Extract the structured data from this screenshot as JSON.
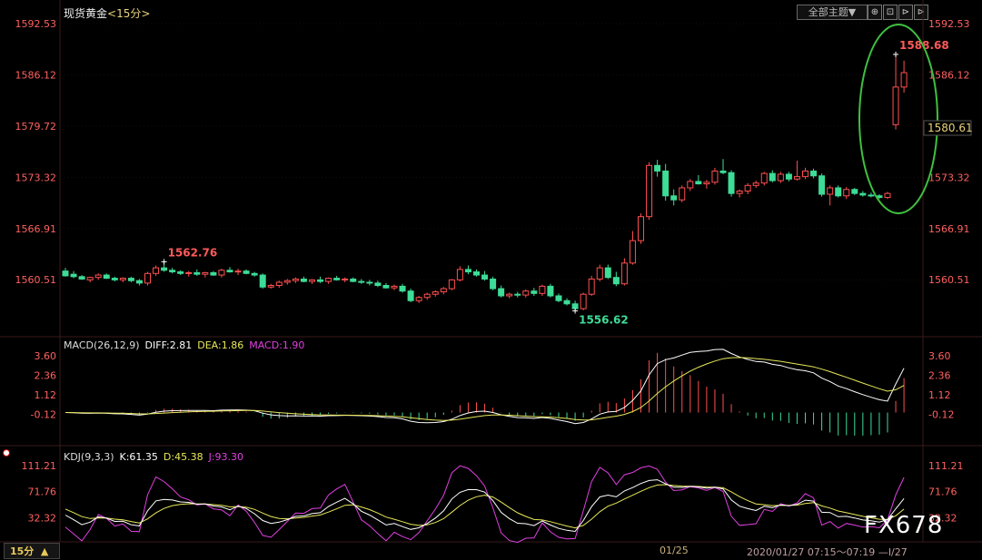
{
  "header": {
    "instrument": "现货黄金",
    "period": "<15分>"
  },
  "toolbar": {
    "theme_label": "全部主题▼",
    "btn1": "⊕",
    "btn2": "⊡",
    "btn3": "⊳",
    "btn4": "⊳"
  },
  "price_axis": {
    "left": [
      "1592.53",
      "1586.12",
      "1579.72",
      "1573.32",
      "1566.91",
      "1560.51"
    ],
    "right": [
      "1592.53",
      "1586.12",
      "1573.32",
      "1566.91",
      "1560.51"
    ],
    "current": "1580.61"
  },
  "annotations": {
    "high_a": "1562.76",
    "low": "1556.62",
    "high_b": "1588.68"
  },
  "macd": {
    "title": "MACD(26,12,9)",
    "diff_label": "DIFF:2.81",
    "dea_label": "DEA:1.86",
    "macd_label": "MACD:1.90",
    "ticks": [
      "3.60",
      "2.36",
      "1.12",
      "-0.12"
    ]
  },
  "kdj": {
    "title": "KDJ(9,3,3)",
    "k_label": "K:61.35",
    "d_label": "D:45.38",
    "j_label": "J:93.30",
    "ticks": [
      "111.21",
      "71.76",
      "32.32"
    ]
  },
  "footer": {
    "period_button": "15分",
    "period_arrow": "▲",
    "date": "01/25",
    "range": "2020/01/27 07:15～07:19",
    "range_end": "—I/27"
  },
  "watermark": "FX678",
  "colors": {
    "up": "#ff4f4f",
    "down": "#3ddc97",
    "diff": "#ffffff",
    "dea": "#e8e85a",
    "j": "#e040e0",
    "highlight": "#3fbf3f"
  },
  "chart_data": {
    "type": "candlestick",
    "instrument": "现货黄金",
    "interval": "15分",
    "ylim": [
      1556.0,
      1592.53
    ],
    "candles": [
      {
        "o": 1561.6,
        "h": 1562.0,
        "l": 1560.9,
        "c": 1561.0
      },
      {
        "o": 1561.2,
        "h": 1561.6,
        "l": 1560.7,
        "c": 1560.9
      },
      {
        "o": 1560.9,
        "h": 1561.1,
        "l": 1560.5,
        "c": 1560.6
      },
      {
        "o": 1560.5,
        "h": 1560.9,
        "l": 1560.2,
        "c": 1560.8
      },
      {
        "o": 1560.8,
        "h": 1561.3,
        "l": 1560.5,
        "c": 1561.1
      },
      {
        "o": 1561.1,
        "h": 1561.3,
        "l": 1560.6,
        "c": 1560.7
      },
      {
        "o": 1560.7,
        "h": 1560.9,
        "l": 1560.3,
        "c": 1560.5
      },
      {
        "o": 1560.5,
        "h": 1560.8,
        "l": 1560.2,
        "c": 1560.7
      },
      {
        "o": 1560.7,
        "h": 1560.9,
        "l": 1560.2,
        "c": 1560.4
      },
      {
        "o": 1560.4,
        "h": 1560.6,
        "l": 1559.8,
        "c": 1560.1
      },
      {
        "o": 1560.1,
        "h": 1561.5,
        "l": 1559.8,
        "c": 1561.3
      },
      {
        "o": 1561.3,
        "h": 1562.3,
        "l": 1561.0,
        "c": 1562.0
      },
      {
        "o": 1562.0,
        "h": 1562.76,
        "l": 1561.5,
        "c": 1561.7
      },
      {
        "o": 1561.7,
        "h": 1562.0,
        "l": 1561.3,
        "c": 1561.5
      },
      {
        "o": 1561.5,
        "h": 1561.7,
        "l": 1561.1,
        "c": 1561.3
      },
      {
        "o": 1561.3,
        "h": 1561.6,
        "l": 1560.9,
        "c": 1561.4
      },
      {
        "o": 1561.4,
        "h": 1561.8,
        "l": 1561.0,
        "c": 1561.2
      },
      {
        "o": 1561.2,
        "h": 1561.5,
        "l": 1560.8,
        "c": 1561.4
      },
      {
        "o": 1561.4,
        "h": 1561.6,
        "l": 1561.0,
        "c": 1561.1
      },
      {
        "o": 1561.1,
        "h": 1561.9,
        "l": 1560.8,
        "c": 1561.7
      },
      {
        "o": 1561.7,
        "h": 1562.1,
        "l": 1561.4,
        "c": 1561.5
      },
      {
        "o": 1561.5,
        "h": 1561.9,
        "l": 1561.1,
        "c": 1561.6
      },
      {
        "o": 1561.6,
        "h": 1561.8,
        "l": 1561.2,
        "c": 1561.3
      },
      {
        "o": 1561.3,
        "h": 1561.5,
        "l": 1560.9,
        "c": 1561.1
      },
      {
        "o": 1561.1,
        "h": 1561.3,
        "l": 1559.4,
        "c": 1559.6
      },
      {
        "o": 1559.6,
        "h": 1560.0,
        "l": 1559.4,
        "c": 1559.8
      },
      {
        "o": 1559.8,
        "h": 1560.4,
        "l": 1559.5,
        "c": 1560.2
      },
      {
        "o": 1560.2,
        "h": 1560.6,
        "l": 1559.9,
        "c": 1560.4
      },
      {
        "o": 1560.4,
        "h": 1560.8,
        "l": 1560.1,
        "c": 1560.6
      },
      {
        "o": 1560.6,
        "h": 1560.9,
        "l": 1560.2,
        "c": 1560.3
      },
      {
        "o": 1560.3,
        "h": 1560.6,
        "l": 1560.0,
        "c": 1560.5
      },
      {
        "o": 1560.5,
        "h": 1560.9,
        "l": 1560.1,
        "c": 1560.3
      },
      {
        "o": 1560.3,
        "h": 1560.8,
        "l": 1560.0,
        "c": 1560.7
      },
      {
        "o": 1560.7,
        "h": 1561.0,
        "l": 1560.4,
        "c": 1560.5
      },
      {
        "o": 1560.5,
        "h": 1560.8,
        "l": 1560.2,
        "c": 1560.6
      },
      {
        "o": 1560.6,
        "h": 1560.8,
        "l": 1560.2,
        "c": 1560.3
      },
      {
        "o": 1560.3,
        "h": 1560.6,
        "l": 1560.0,
        "c": 1560.2
      },
      {
        "o": 1560.2,
        "h": 1560.5,
        "l": 1559.8,
        "c": 1560.1
      },
      {
        "o": 1560.1,
        "h": 1560.4,
        "l": 1559.6,
        "c": 1559.8
      },
      {
        "o": 1559.8,
        "h": 1560.1,
        "l": 1559.4,
        "c": 1559.5
      },
      {
        "o": 1559.5,
        "h": 1559.9,
        "l": 1559.2,
        "c": 1559.7
      },
      {
        "o": 1559.7,
        "h": 1560.0,
        "l": 1558.9,
        "c": 1559.1
      },
      {
        "o": 1559.1,
        "h": 1559.4,
        "l": 1557.7,
        "c": 1557.9
      },
      {
        "o": 1557.9,
        "h": 1558.5,
        "l": 1557.6,
        "c": 1558.3
      },
      {
        "o": 1558.3,
        "h": 1558.9,
        "l": 1558.0,
        "c": 1558.7
      },
      {
        "o": 1558.7,
        "h": 1559.2,
        "l": 1558.4,
        "c": 1559.0
      },
      {
        "o": 1559.0,
        "h": 1559.6,
        "l": 1558.7,
        "c": 1559.4
      },
      {
        "o": 1559.4,
        "h": 1560.6,
        "l": 1559.2,
        "c": 1560.5
      },
      {
        "o": 1560.5,
        "h": 1562.2,
        "l": 1560.3,
        "c": 1561.8
      },
      {
        "o": 1561.8,
        "h": 1562.3,
        "l": 1561.2,
        "c": 1561.5
      },
      {
        "o": 1561.5,
        "h": 1561.8,
        "l": 1560.9,
        "c": 1561.1
      },
      {
        "o": 1561.1,
        "h": 1561.6,
        "l": 1560.4,
        "c": 1560.6
      },
      {
        "o": 1560.6,
        "h": 1560.9,
        "l": 1559.2,
        "c": 1559.4
      },
      {
        "o": 1559.4,
        "h": 1559.8,
        "l": 1558.3,
        "c": 1558.5
      },
      {
        "o": 1558.5,
        "h": 1558.9,
        "l": 1558.2,
        "c": 1558.7
      },
      {
        "o": 1558.7,
        "h": 1559.0,
        "l": 1558.3,
        "c": 1558.6
      },
      {
        "o": 1558.6,
        "h": 1559.3,
        "l": 1558.3,
        "c": 1559.1
      },
      {
        "o": 1559.1,
        "h": 1559.5,
        "l": 1558.5,
        "c": 1558.8
      },
      {
        "o": 1558.8,
        "h": 1559.9,
        "l": 1558.5,
        "c": 1559.7
      },
      {
        "o": 1559.7,
        "h": 1560.0,
        "l": 1558.3,
        "c": 1558.5
      },
      {
        "o": 1558.5,
        "h": 1558.8,
        "l": 1557.7,
        "c": 1557.9
      },
      {
        "o": 1557.9,
        "h": 1558.2,
        "l": 1557.3,
        "c": 1557.5
      },
      {
        "o": 1557.5,
        "h": 1557.9,
        "l": 1556.62,
        "c": 1556.9
      },
      {
        "o": 1556.9,
        "h": 1558.9,
        "l": 1556.7,
        "c": 1558.7
      },
      {
        "o": 1558.7,
        "h": 1561.0,
        "l": 1558.5,
        "c": 1560.6
      },
      {
        "o": 1560.6,
        "h": 1562.4,
        "l": 1560.3,
        "c": 1562.0
      },
      {
        "o": 1562.0,
        "h": 1562.4,
        "l": 1560.6,
        "c": 1560.8
      },
      {
        "o": 1560.8,
        "h": 1561.5,
        "l": 1559.7,
        "c": 1560.0
      },
      {
        "o": 1560.0,
        "h": 1563.2,
        "l": 1559.8,
        "c": 1562.6
      },
      {
        "o": 1562.6,
        "h": 1566.6,
        "l": 1562.4,
        "c": 1565.4
      },
      {
        "o": 1565.4,
        "h": 1568.8,
        "l": 1565.0,
        "c": 1568.4
      },
      {
        "o": 1568.4,
        "h": 1575.2,
        "l": 1568.0,
        "c": 1574.8
      },
      {
        "o": 1574.8,
        "h": 1575.5,
        "l": 1573.4,
        "c": 1574.1
      },
      {
        "o": 1574.1,
        "h": 1575.0,
        "l": 1570.4,
        "c": 1571.0
      },
      {
        "o": 1571.0,
        "h": 1571.8,
        "l": 1569.8,
        "c": 1570.5
      },
      {
        "o": 1570.5,
        "h": 1572.3,
        "l": 1570.2,
        "c": 1572.0
      },
      {
        "o": 1572.0,
        "h": 1573.1,
        "l": 1571.6,
        "c": 1572.8
      },
      {
        "o": 1572.8,
        "h": 1573.6,
        "l": 1572.4,
        "c": 1572.5
      },
      {
        "o": 1572.5,
        "h": 1573.0,
        "l": 1571.9,
        "c": 1572.7
      },
      {
        "o": 1572.7,
        "h": 1574.5,
        "l": 1572.4,
        "c": 1574.1
      },
      {
        "o": 1574.1,
        "h": 1575.6,
        "l": 1573.7,
        "c": 1573.9
      },
      {
        "o": 1573.9,
        "h": 1574.2,
        "l": 1570.9,
        "c": 1571.3
      },
      {
        "o": 1571.3,
        "h": 1571.8,
        "l": 1570.8,
        "c": 1571.6
      },
      {
        "o": 1571.6,
        "h": 1572.6,
        "l": 1571.2,
        "c": 1572.3
      },
      {
        "o": 1572.3,
        "h": 1572.9,
        "l": 1572.0,
        "c": 1572.6
      },
      {
        "o": 1572.6,
        "h": 1574.0,
        "l": 1572.3,
        "c": 1573.8
      },
      {
        "o": 1573.8,
        "h": 1574.2,
        "l": 1572.7,
        "c": 1572.9
      },
      {
        "o": 1572.9,
        "h": 1574.0,
        "l": 1572.6,
        "c": 1573.7
      },
      {
        "o": 1573.7,
        "h": 1574.0,
        "l": 1572.8,
        "c": 1573.1
      },
      {
        "o": 1573.1,
        "h": 1575.4,
        "l": 1572.9,
        "c": 1573.4
      },
      {
        "o": 1573.4,
        "h": 1574.5,
        "l": 1573.1,
        "c": 1574.1
      },
      {
        "o": 1574.1,
        "h": 1574.4,
        "l": 1573.2,
        "c": 1573.5
      },
      {
        "o": 1573.5,
        "h": 1573.8,
        "l": 1570.9,
        "c": 1571.2
      },
      {
        "o": 1571.2,
        "h": 1572.3,
        "l": 1569.8,
        "c": 1572.0
      },
      {
        "o": 1572.0,
        "h": 1572.3,
        "l": 1570.8,
        "c": 1571.0
      },
      {
        "o": 1571.0,
        "h": 1572.1,
        "l": 1570.6,
        "c": 1571.8
      },
      {
        "o": 1571.8,
        "h": 1572.0,
        "l": 1571.1,
        "c": 1571.3
      },
      {
        "o": 1571.3,
        "h": 1571.6,
        "l": 1570.9,
        "c": 1571.1
      },
      {
        "o": 1571.1,
        "h": 1571.4,
        "l": 1570.8,
        "c": 1571.0
      },
      {
        "o": 1571.0,
        "h": 1571.2,
        "l": 1570.6,
        "c": 1570.8
      },
      {
        "o": 1570.8,
        "h": 1571.5,
        "l": 1570.6,
        "c": 1571.3
      },
      {
        "o": 1579.9,
        "h": 1588.68,
        "l": 1579.3,
        "c": 1584.6
      },
      {
        "o": 1584.6,
        "h": 1587.9,
        "l": 1583.9,
        "c": 1586.4
      }
    ],
    "macd": {
      "diff_end": 2.81,
      "dea_end": 1.86,
      "macd_end": 1.9,
      "ylim": [
        -1.35,
        3.6
      ]
    },
    "kdj": {
      "k_end": 61.35,
      "d_end": 45.38,
      "j_end": 93.3,
      "ylim": [
        0,
        111.21
      ]
    }
  }
}
